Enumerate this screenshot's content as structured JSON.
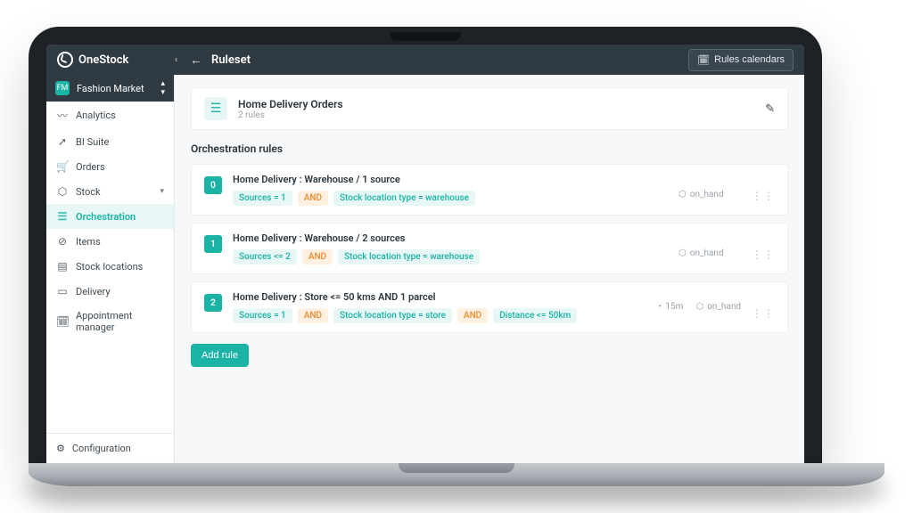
{
  "brand": "OneStock",
  "header": {
    "title": "Ruleset",
    "rules_calendars_label": "Rules calendars"
  },
  "workspace": {
    "name": "Fashion Market",
    "badge_initials": "FM"
  },
  "sidebar": {
    "items": [
      {
        "label": "Analytics",
        "icon": "chart"
      },
      {
        "label": "BI Suite",
        "icon": "trend"
      },
      {
        "label": "Orders",
        "icon": "cart"
      },
      {
        "label": "Stock",
        "icon": "cube",
        "expandable": true
      },
      {
        "label": "Orchestration",
        "icon": "list",
        "active": true
      },
      {
        "label": "Items",
        "icon": "tag"
      },
      {
        "label": "Stock locations",
        "icon": "store"
      },
      {
        "label": "Delivery",
        "icon": "truck"
      },
      {
        "label": "Appointment manager",
        "icon": "calendar"
      }
    ],
    "bottom": {
      "label": "Configuration",
      "icon": "sliders"
    }
  },
  "ruleset": {
    "title": "Home Delivery Orders",
    "subtitle": "2 rules"
  },
  "section_title": "Orchestration rules",
  "rules": [
    {
      "index": "0",
      "title": "Home Delivery : Warehouse / 1 source",
      "chips": [
        "Sources = 1",
        "AND",
        "Stock location type = warehouse"
      ],
      "tags": [
        {
          "icon": "cube",
          "text": "on_hand"
        }
      ]
    },
    {
      "index": "1",
      "title": "Home Delivery : Warehouse / 2 sources",
      "chips": [
        "Sources <= 2",
        "AND",
        "Stock location type = warehouse"
      ],
      "tags": [
        {
          "icon": "cube",
          "text": "on_hand"
        }
      ]
    },
    {
      "index": "2",
      "title": "Home Delivery : Store <= 50 kms AND 1 parcel",
      "chips": [
        "Sources = 1",
        "AND",
        "Stock location type = store",
        "AND",
        "Distance <= 50km"
      ],
      "tags": [
        {
          "icon": "clock",
          "text": "15m"
        },
        {
          "icon": "cube",
          "text": "on_hand"
        }
      ]
    }
  ],
  "add_rule_label": "Add rule"
}
